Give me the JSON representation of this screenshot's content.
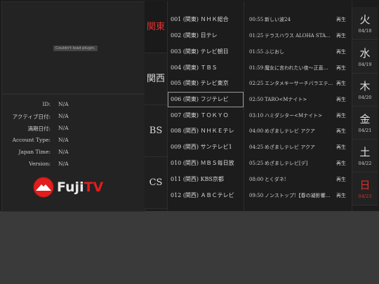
{
  "preview": {
    "message": "Couldn't load plugin."
  },
  "info": {
    "rows": [
      {
        "key": "ID:",
        "value": "N/A"
      },
      {
        "key": "アクティブ日付:",
        "value": "N/A"
      },
      {
        "key": "満期日付:",
        "value": "N/A"
      },
      {
        "key": "Account Type:",
        "value": "N/A"
      },
      {
        "key": "Japan Time:",
        "value": "N/A"
      },
      {
        "key": "Version:",
        "value": "N/A"
      }
    ]
  },
  "logo": {
    "text_main": "Fuji",
    "text_tv": "TV",
    "accent": "#e21d1d"
  },
  "regions": [
    "関東",
    "関西",
    "BS",
    "CS"
  ],
  "channels": [
    "001 (関東) ＮＨＫ総合",
    "002 (関東) 日テレ",
    "003 (関東) テレビ朝日",
    "004 (関東) ＴＢＳ",
    "005 (関東) テレビ東京",
    "006 (関東) フジテレビ",
    "007 (関東) ＴＯＫＹＯ",
    "008 (関西) ＮＨＫＥテレ",
    "009 (関西) サンテレビ1",
    "010 (関西) ＭＢＳ毎日放",
    "011 (関西) KBS京都",
    "012 (関西) ＡＢＣテレビ"
  ],
  "programs": [
    {
      "time": "00:55",
      "title": "新しい波24",
      "action": "再生"
    },
    {
      "time": "01:25",
      "title": "テラスハウス ALOHA STATE…",
      "action": "再生"
    },
    {
      "time": "01:55",
      "title": "ふじおし",
      "action": "再生"
    },
    {
      "time": "01:59",
      "title": "魔女に言われたい夜〜正直…",
      "action": "再生"
    },
    {
      "time": "02:25",
      "title": "エンタメキーサーチバラエティ…",
      "action": "再生"
    },
    {
      "time": "02:50",
      "title": "TARO<Mナイト>",
      "action": "再生"
    },
    {
      "time": "03:10",
      "title": "ハミダシター<Mナイト>",
      "action": "再生"
    },
    {
      "time": "04:00",
      "title": "めざましテレビ アクア",
      "action": "再生"
    },
    {
      "time": "04:25",
      "title": "めざましテレビ アクア",
      "action": "再生"
    },
    {
      "time": "05:25",
      "title": "めざましテレビ[デ]",
      "action": "再生"
    },
    {
      "time": "08:00",
      "title": "とくダネ!",
      "action": "再生"
    },
    {
      "time": "09:50",
      "title": "ノンストップ!【春の凝影響…",
      "action": "再生"
    }
  ],
  "days": [
    {
      "kanji": "火",
      "date": "04/18"
    },
    {
      "kanji": "水",
      "date": "04/19"
    },
    {
      "kanji": "木",
      "date": "04/20"
    },
    {
      "kanji": "金",
      "date": "04/21"
    },
    {
      "kanji": "土",
      "date": "04/22"
    },
    {
      "kanji": "日",
      "date": "04/23"
    }
  ],
  "colors": {
    "active_red": "#e03030",
    "panel": "#1c1c1c",
    "backdrop": "#3a3a3a"
  }
}
